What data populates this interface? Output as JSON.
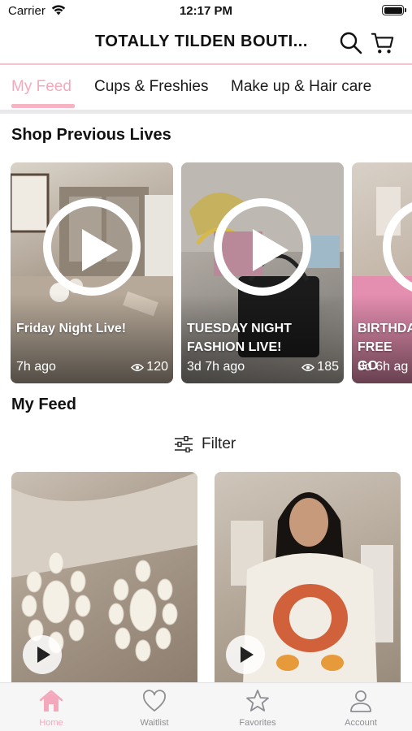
{
  "status_bar": {
    "carrier": "Carrier",
    "time": "12:17 PM"
  },
  "header": {
    "title": "TOTALLY TILDEN BOUTI..."
  },
  "tabs": [
    {
      "label": "My Feed",
      "active": true
    },
    {
      "label": "Cups & Freshies",
      "active": false
    },
    {
      "label": "Make up & Hair care",
      "active": false
    }
  ],
  "previous_lives": {
    "title": "Shop Previous Lives",
    "items": [
      {
        "title": "Friday Night Live!",
        "ago": "7h ago",
        "views": "120"
      },
      {
        "title": "TUESDAY NIGHT FASHION LIVE!",
        "ago": "3d 7h ago",
        "views": "185"
      },
      {
        "title": "BIRTHDA FREE GO",
        "ago": "8d 6h ag",
        "views": ""
      }
    ]
  },
  "feed": {
    "title": "My Feed",
    "filter_label": "Filter"
  },
  "tab_bar": [
    {
      "label": "Home",
      "icon": "home-icon",
      "active": true
    },
    {
      "label": "Waitlist",
      "icon": "heart-icon",
      "active": false
    },
    {
      "label": "Favorites",
      "icon": "star-icon",
      "active": false
    },
    {
      "label": "Account",
      "icon": "person-icon",
      "active": false
    }
  ],
  "colors": {
    "accent_pink": "#f3a9bb",
    "divider_pink": "#f4c3cf"
  }
}
